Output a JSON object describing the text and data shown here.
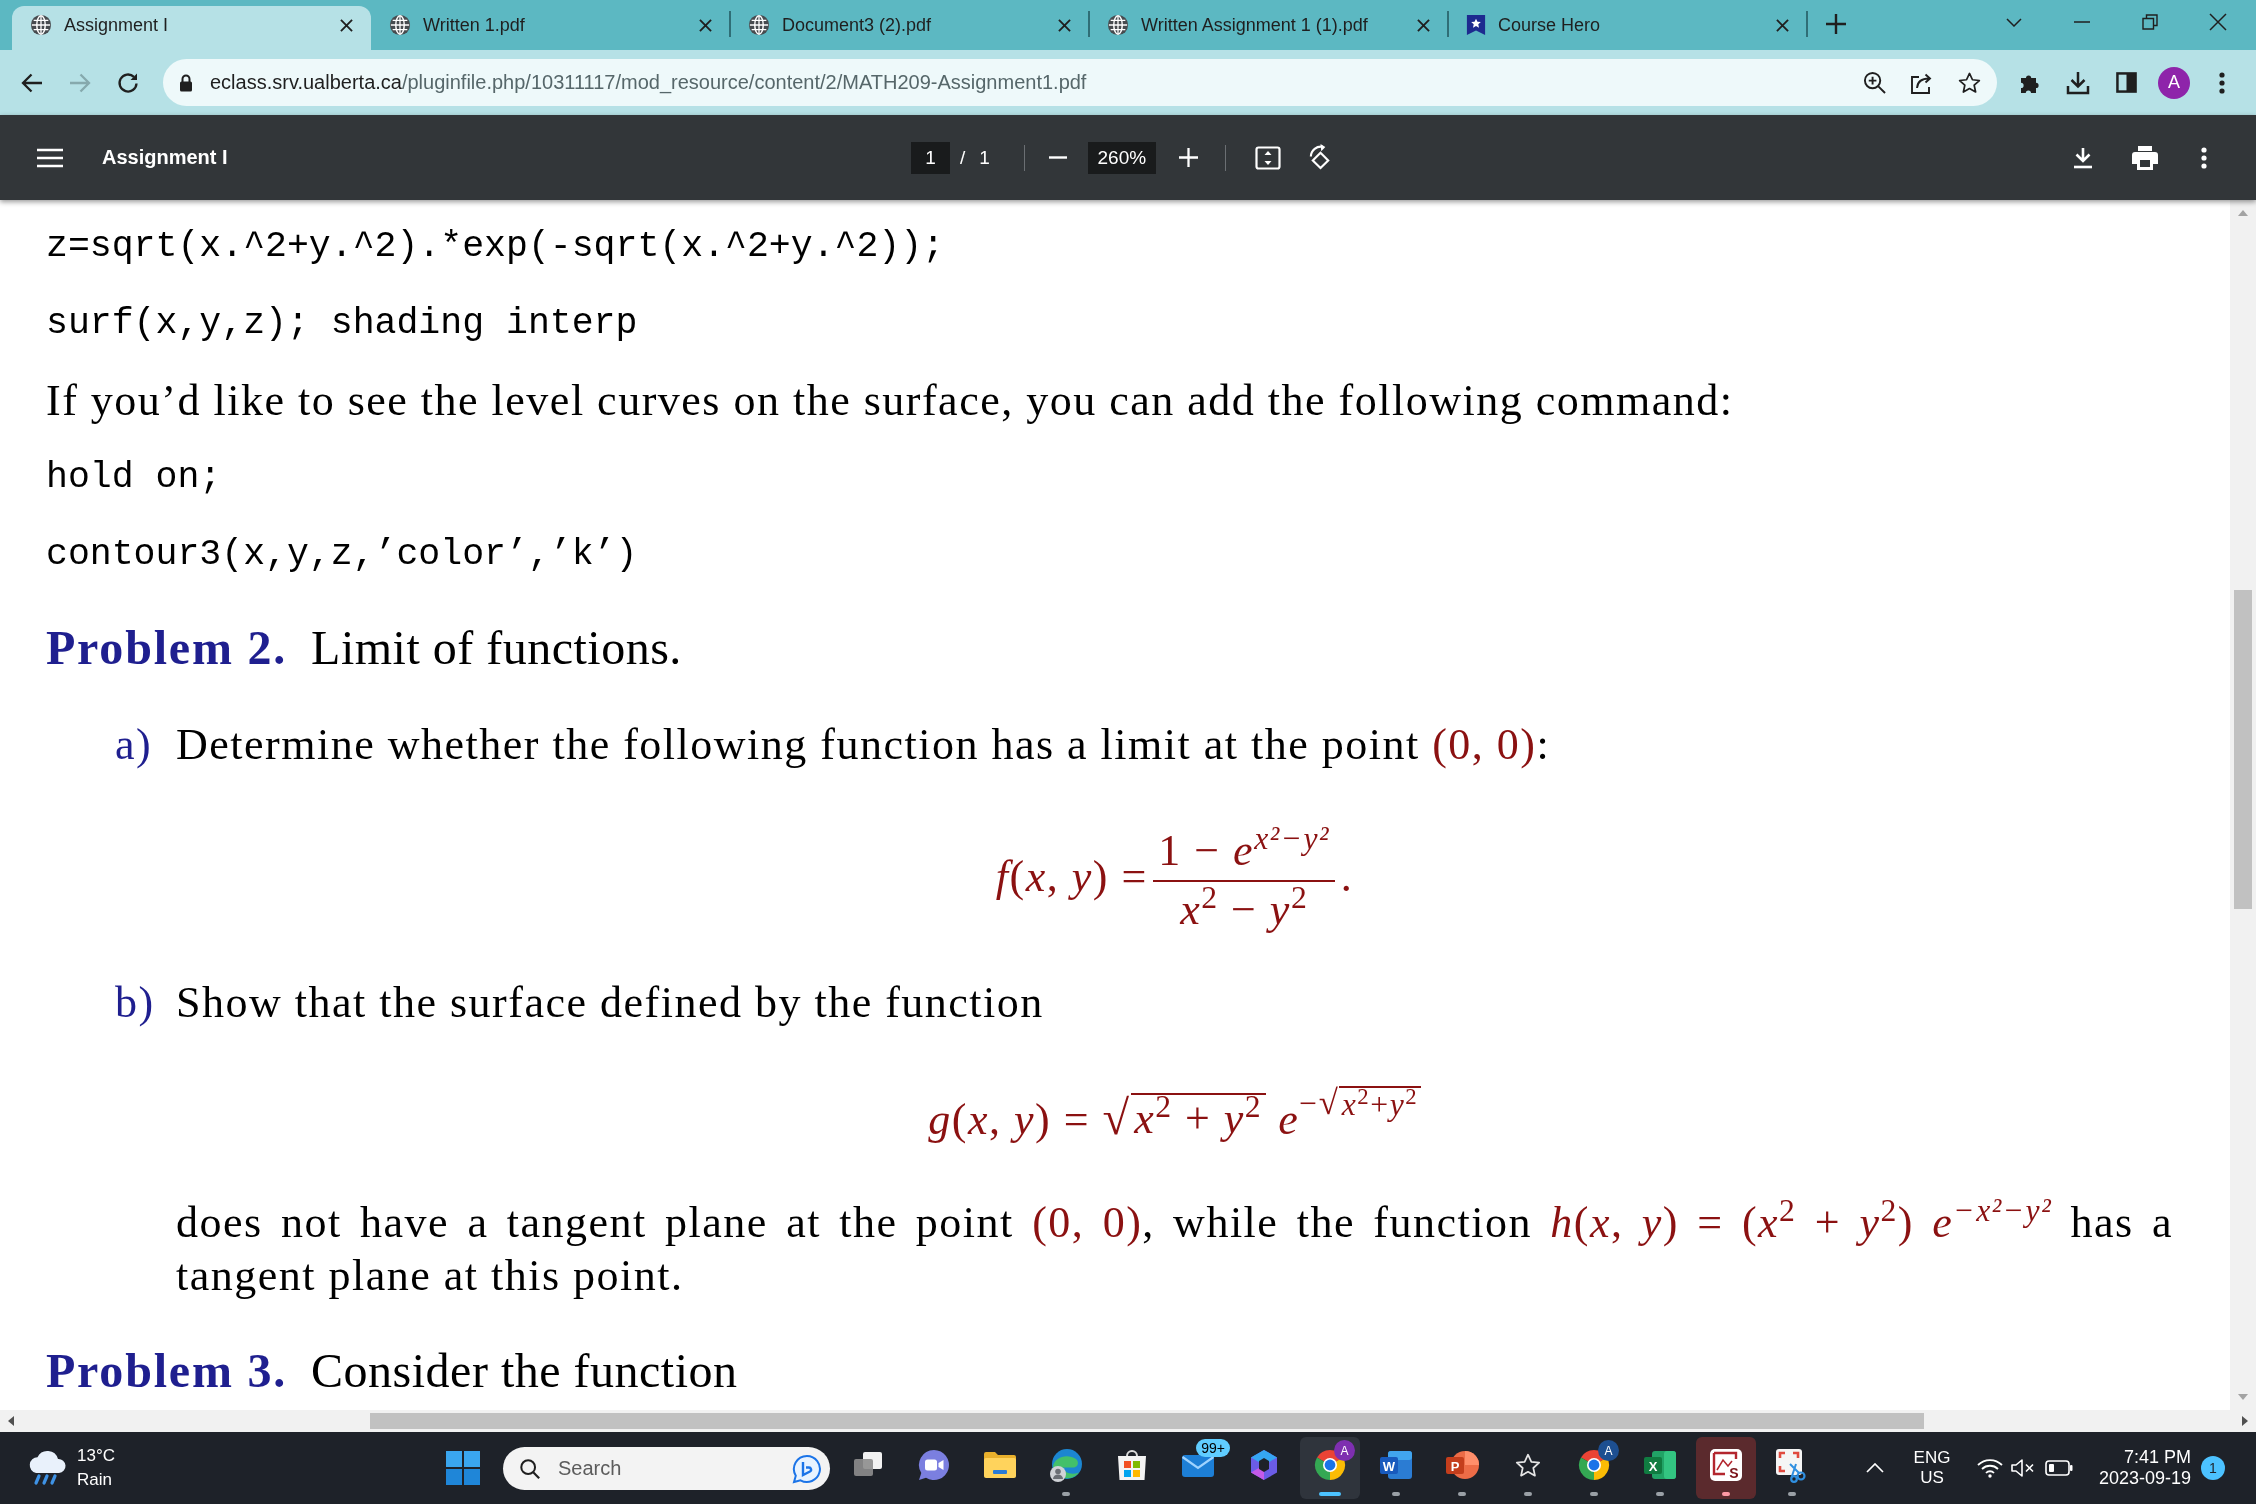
{
  "tabs": [
    {
      "kind": "web",
      "title": "Assignment I",
      "selected": true
    },
    {
      "kind": "web",
      "title": "Written 1.pdf",
      "selected": false
    },
    {
      "kind": "web",
      "title": "Document3 (2).pdf",
      "selected": false
    },
    {
      "kind": "web",
      "title": "Written Assignment 1 (1).pdf",
      "selected": false
    },
    {
      "kind": "shield",
      "title": "Course Hero",
      "selected": false
    }
  ],
  "address_bar": {
    "forward_disabled": true,
    "url_host": "eclass.srv.ualberta.ca",
    "url_path": "/pluginfile.php/10311117/mod_resource/content/2/MATH209-Assignment1.pdf",
    "profile_initial": "A"
  },
  "pdf_toolbar": {
    "title": "Assignment I",
    "page": "1",
    "page_divider": "/",
    "page_count": "1",
    "zoom": "260%"
  },
  "document": {
    "blocks": [
      {
        "kind": "code",
        "text": "z=sqrt(x.^2+y.^2).*exp(-sqrt(x.^2+y.^2));"
      },
      {
        "kind": "code",
        "text": "surf(x,y,z); shading interp"
      },
      {
        "kind": "paragraph",
        "segments": [
          {
            "kind": "text",
            "text": "If you’d like to see the level curves on the surface, you can add the following command:"
          }
        ]
      },
      {
        "kind": "code",
        "text": "hold on;"
      },
      {
        "kind": "code",
        "text": "contour3(x,y,z,’color’,’k’)"
      },
      {
        "kind": "problem",
        "label": "Problem 2.",
        "title": "Limit of functions."
      },
      {
        "kind": "item",
        "label": "a)",
        "segments": [
          {
            "kind": "text",
            "text": "Determine whether the following function has a limit at the point "
          },
          {
            "kind": "math",
            "parts": [
              {
                "kind": "text",
                "text": "(0, 0)"
              }
            ]
          },
          {
            "kind": "text",
            "text": ":"
          }
        ]
      },
      {
        "kind": "display",
        "parts": [
          {
            "kind": "text",
            "text": "*f*(*x*, *y*) ="
          },
          {
            "kind": "frac",
            "numerator": [
              {
                "kind": "text",
                "text": "1 − *e*$^{x²−y²}$"
              }
            ],
            "denominator": [
              {
                "kind": "text",
                "text": "*x*$^{2}$ − *y*$^{2}$"
              }
            ]
          },
          {
            "kind": "text",
            "text": "."
          }
        ]
      },
      {
        "kind": "item",
        "label": "b)",
        "segments": [
          {
            "kind": "text",
            "text": "Show that the surface defined by the function"
          }
        ]
      },
      {
        "kind": "display",
        "parts": [
          {
            "kind": "text",
            "text": "*g*(*x*, *y*) = "
          },
          {
            "kind": "sqrt",
            "sign": "√",
            "radicand": [
              {
                "kind": "text",
                "text": "*x*$^{2}$ + *y*$^{2}$"
              }
            ]
          },
          {
            "kind": "text",
            "text": " *e*"
          },
          {
            "kind": "sup",
            "parts": [
              {
                "kind": "text",
                "text": "−"
              },
              {
                "kind": "sqrt",
                "sign": "√",
                "radicand": [
                  {
                    "kind": "text",
                    "text": "*x*$^{2}$+*y*$^{2}$"
                  }
                ]
              }
            ]
          }
        ]
      },
      {
        "kind": "item",
        "segments": [
          {
            "kind": "text",
            "text": "does not have a tangent plane at the point "
          },
          {
            "kind": "math",
            "parts": [
              {
                "kind": "text",
                "text": "(0, 0)"
              }
            ]
          },
          {
            "kind": "text",
            "text": ", while the function "
          },
          {
            "kind": "math",
            "parts": [
              {
                "kind": "text",
                "text": "*h*(*x*, *y*) = (*x*$^{2}$ + *y*$^{2}$) *e*$^{−x²−y²}$"
              }
            ]
          },
          {
            "kind": "text",
            "text": " has a tangent plane at this point."
          }
        ]
      },
      {
        "kind": "problem",
        "label": "Problem 3.",
        "title": "Consider the function"
      }
    ]
  },
  "taskbar": {
    "weather": {
      "temperature": "13°C",
      "condition": "Rain"
    },
    "search": {
      "placeholder": "Search"
    },
    "apps": [
      {
        "kind": "stacked-windows",
        "running": false,
        "focused": false,
        "flashing": false
      },
      {
        "kind": "video-chat",
        "running": false,
        "focused": false,
        "flashing": false
      },
      {
        "kind": "folder",
        "running": false,
        "focused": false,
        "flashing": false
      },
      {
        "kind": "swirl-browser",
        "running": true,
        "focused": false,
        "flashing": false
      },
      {
        "kind": "shop-bag",
        "running": false,
        "focused": false,
        "flashing": false
      },
      {
        "kind": "mail",
        "running": false,
        "focused": false,
        "flashing": false,
        "badge": "99+"
      },
      {
        "kind": "ribbon",
        "running": false,
        "focused": false,
        "flashing": false
      },
      {
        "kind": "round-browser",
        "running": true,
        "focused": true,
        "flashing": false,
        "profile_badge": {
          "text": "A",
          "color": "#7e2fb0"
        }
      },
      {
        "kind": "w-tile",
        "running": true,
        "focused": false,
        "flashing": false,
        "glyph": "W"
      },
      {
        "kind": "p-tile",
        "running": true,
        "focused": false,
        "flashing": false,
        "glyph": "P"
      },
      {
        "kind": "star",
        "running": true,
        "focused": false,
        "flashing": false
      },
      {
        "kind": "round-browser",
        "running": true,
        "focused": false,
        "flashing": false,
        "profile_badge": {
          "text": "A",
          "color": "#1d4f91"
        }
      },
      {
        "kind": "x-tile",
        "running": true,
        "focused": false,
        "flashing": false,
        "glyph": "X"
      },
      {
        "kind": "red-frame-tile",
        "running": true,
        "focused": false,
        "flashing": true,
        "glyph": "S"
      },
      {
        "kind": "scissors-tile",
        "running": true,
        "focused": false,
        "flashing": false
      }
    ],
    "tray": {
      "language": "ENG",
      "region": "US",
      "time": "7:41 PM",
      "date": "2023-09-19",
      "notifications": "1"
    }
  }
}
